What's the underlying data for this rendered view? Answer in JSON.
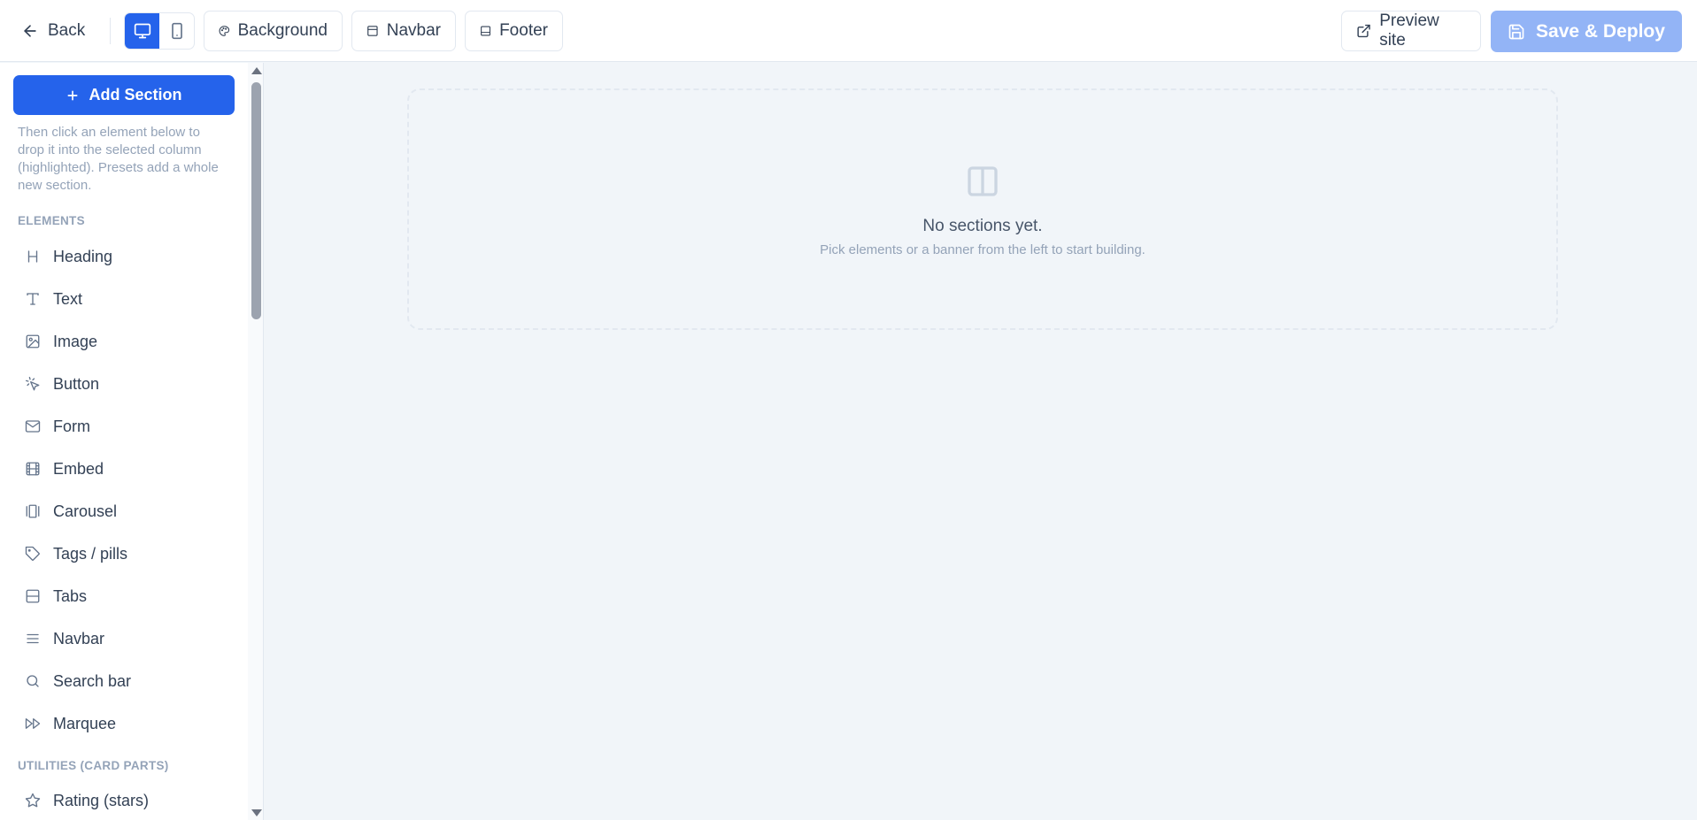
{
  "toolbar": {
    "back_label": "Back",
    "background_label": "Background",
    "navbar_label": "Navbar",
    "footer_label": "Footer",
    "preview_label": "Preview site",
    "save_label": "Save & Deploy"
  },
  "sidebar": {
    "add_section_label": "Add Section",
    "help_text": "Then click an element below to drop it into the selected column (highlighted). Presets add a whole new section.",
    "elements_heading": "ELEMENTS",
    "elements": [
      {
        "label": "Heading",
        "icon": "heading-icon"
      },
      {
        "label": "Text",
        "icon": "text-icon"
      },
      {
        "label": "Image",
        "icon": "image-icon"
      },
      {
        "label": "Button",
        "icon": "cursor-click-icon"
      },
      {
        "label": "Form",
        "icon": "mail-icon"
      },
      {
        "label": "Embed",
        "icon": "film-icon"
      },
      {
        "label": "Carousel",
        "icon": "carousel-icon"
      },
      {
        "label": "Tags / pills",
        "icon": "tag-icon"
      },
      {
        "label": "Tabs",
        "icon": "tabs-icon"
      },
      {
        "label": "Navbar",
        "icon": "menu-icon"
      },
      {
        "label": "Search bar",
        "icon": "search-icon"
      },
      {
        "label": "Marquee",
        "icon": "fast-forward-icon"
      }
    ],
    "utilities_heading": "UTILITIES (CARD PARTS)",
    "utilities": [
      {
        "label": "Rating (stars)",
        "icon": "star-icon"
      }
    ]
  },
  "canvas": {
    "empty_title": "No sections yet.",
    "empty_subtitle": "Pick elements or a banner from the left to start building."
  },
  "colors": {
    "accent": "#2563eb",
    "save_disabled": "#93b4f6"
  }
}
